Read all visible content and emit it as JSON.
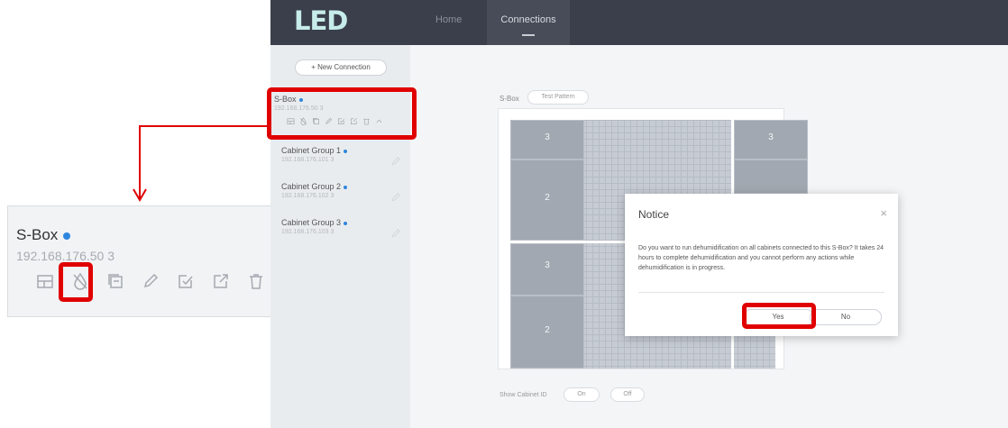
{
  "zoom": {
    "device_name": "S-Box",
    "device_ip": "192.168.176.50",
    "device_ip_suffix": "3",
    "icons": [
      "layout-icon",
      "dehumidify-icon",
      "copy-icon",
      "edit-icon",
      "check-edit-icon",
      "export-icon",
      "delete-icon",
      "chevron-up-icon"
    ]
  },
  "app": {
    "logo": "LED",
    "nav": {
      "home": "Home",
      "connections": "Connections"
    },
    "sidebar": {
      "new_connection": "+ New Connection",
      "sbox": {
        "name": "S-Box",
        "ip": "192.168.176.50 3"
      },
      "items": [
        {
          "name": "Cabinet Group 1",
          "ip": "192.168.176.101 3"
        },
        {
          "name": "Cabinet Group 2",
          "ip": "192.168.176.102 3"
        },
        {
          "name": "Cabinet Group 3",
          "ip": "192.168.176.103 3"
        }
      ]
    },
    "main": {
      "sbox_label": "S-Box",
      "test_pattern": "Test Pattern",
      "cabinets": [
        "3",
        "2",
        "3",
        "2",
        "3",
        "3"
      ],
      "show_cabinet_id": "Show Cabinet ID",
      "on": "On",
      "off": "Off"
    },
    "dialog": {
      "title": "Notice",
      "close": "×",
      "message": "Do you want to run dehumidification on all cabinets connected to this S-Box? It takes 24 hours to complete dehumidification and you cannot perform any actions while dehumidification is in progress.",
      "yes": "Yes",
      "no": "No"
    }
  },
  "colors": {
    "highlight": "#e00000",
    "status_dot": "#2e86de",
    "topbar": "#3a3f4b"
  }
}
